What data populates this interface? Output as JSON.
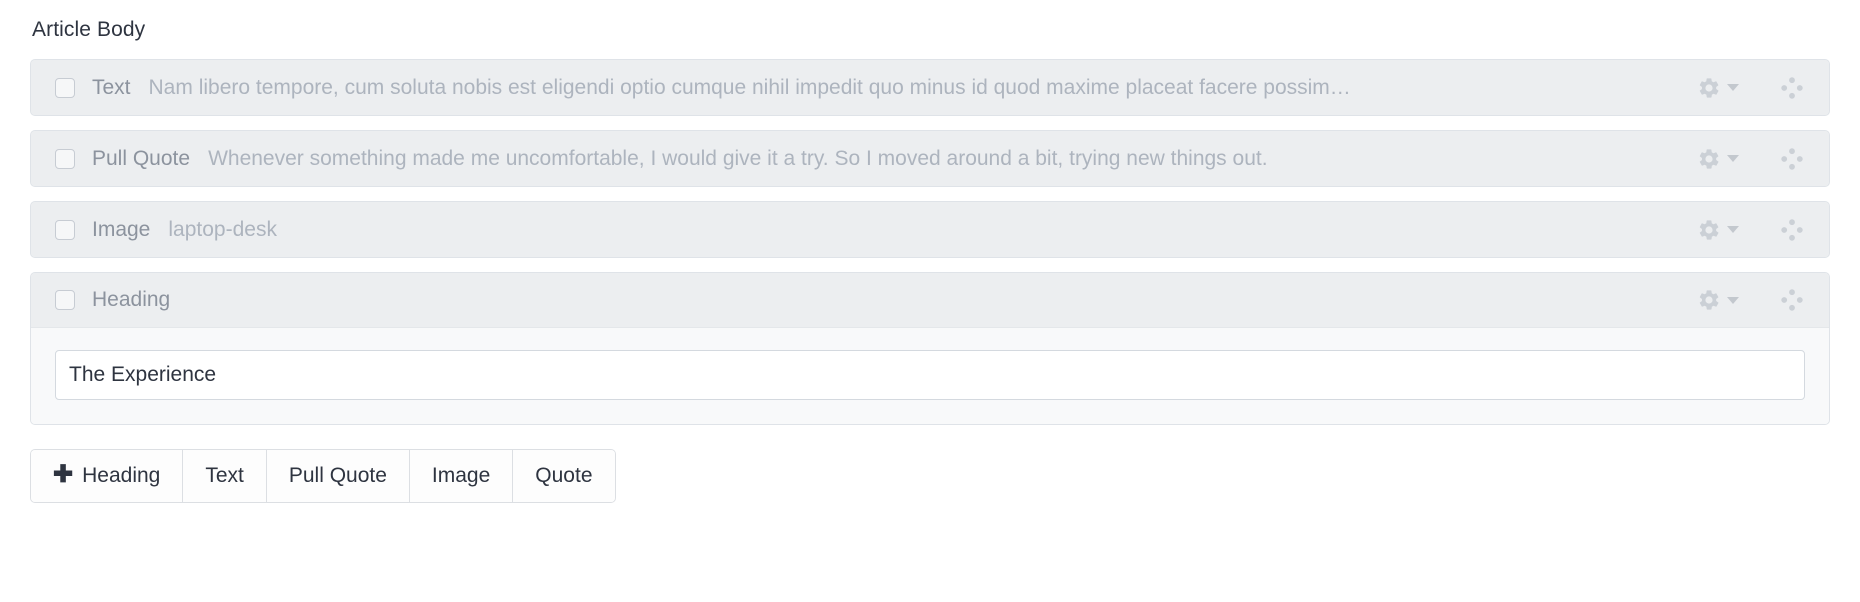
{
  "section": {
    "title": "Article Body"
  },
  "blocks": [
    {
      "type": "Text",
      "preview": "Nam libero tempore, cum soluta nobis est eligendi optio cumque nihil impedit quo minus id quod maxime placeat facere possim…",
      "expanded": false
    },
    {
      "type": "Pull Quote",
      "preview": "Whenever something made me uncomfortable, I would give it a try. So I moved around a bit, trying new things out.",
      "expanded": false
    },
    {
      "type": "Image",
      "preview": "laptop-desk",
      "expanded": false
    },
    {
      "type": "Heading",
      "preview": "",
      "expanded": true,
      "field_value": "The Experience",
      "field_placeholder": ""
    }
  ],
  "toolbar": {
    "add_icon": "plus-icon",
    "buttons": [
      {
        "label": "Heading",
        "has_plus": true
      },
      {
        "label": "Text",
        "has_plus": false
      },
      {
        "label": "Pull Quote",
        "has_plus": false
      },
      {
        "label": "Image",
        "has_plus": false
      },
      {
        "label": "Quote",
        "has_plus": false
      }
    ]
  },
  "icons": {
    "settings": "gear-icon",
    "settings_caret": "chevron-down-icon",
    "drag": "move-handle-icon",
    "checkbox": "checkbox-unchecked-icon"
  },
  "colors": {
    "row_header_bg": "#eceef0",
    "row_border": "#dfe3e8",
    "expanded_bg": "#f8f9fa",
    "type_label": "#8c939e",
    "preview_text": "#adb4be",
    "title_text": "#2e3440",
    "icon_gray": "#cbd0d6"
  }
}
